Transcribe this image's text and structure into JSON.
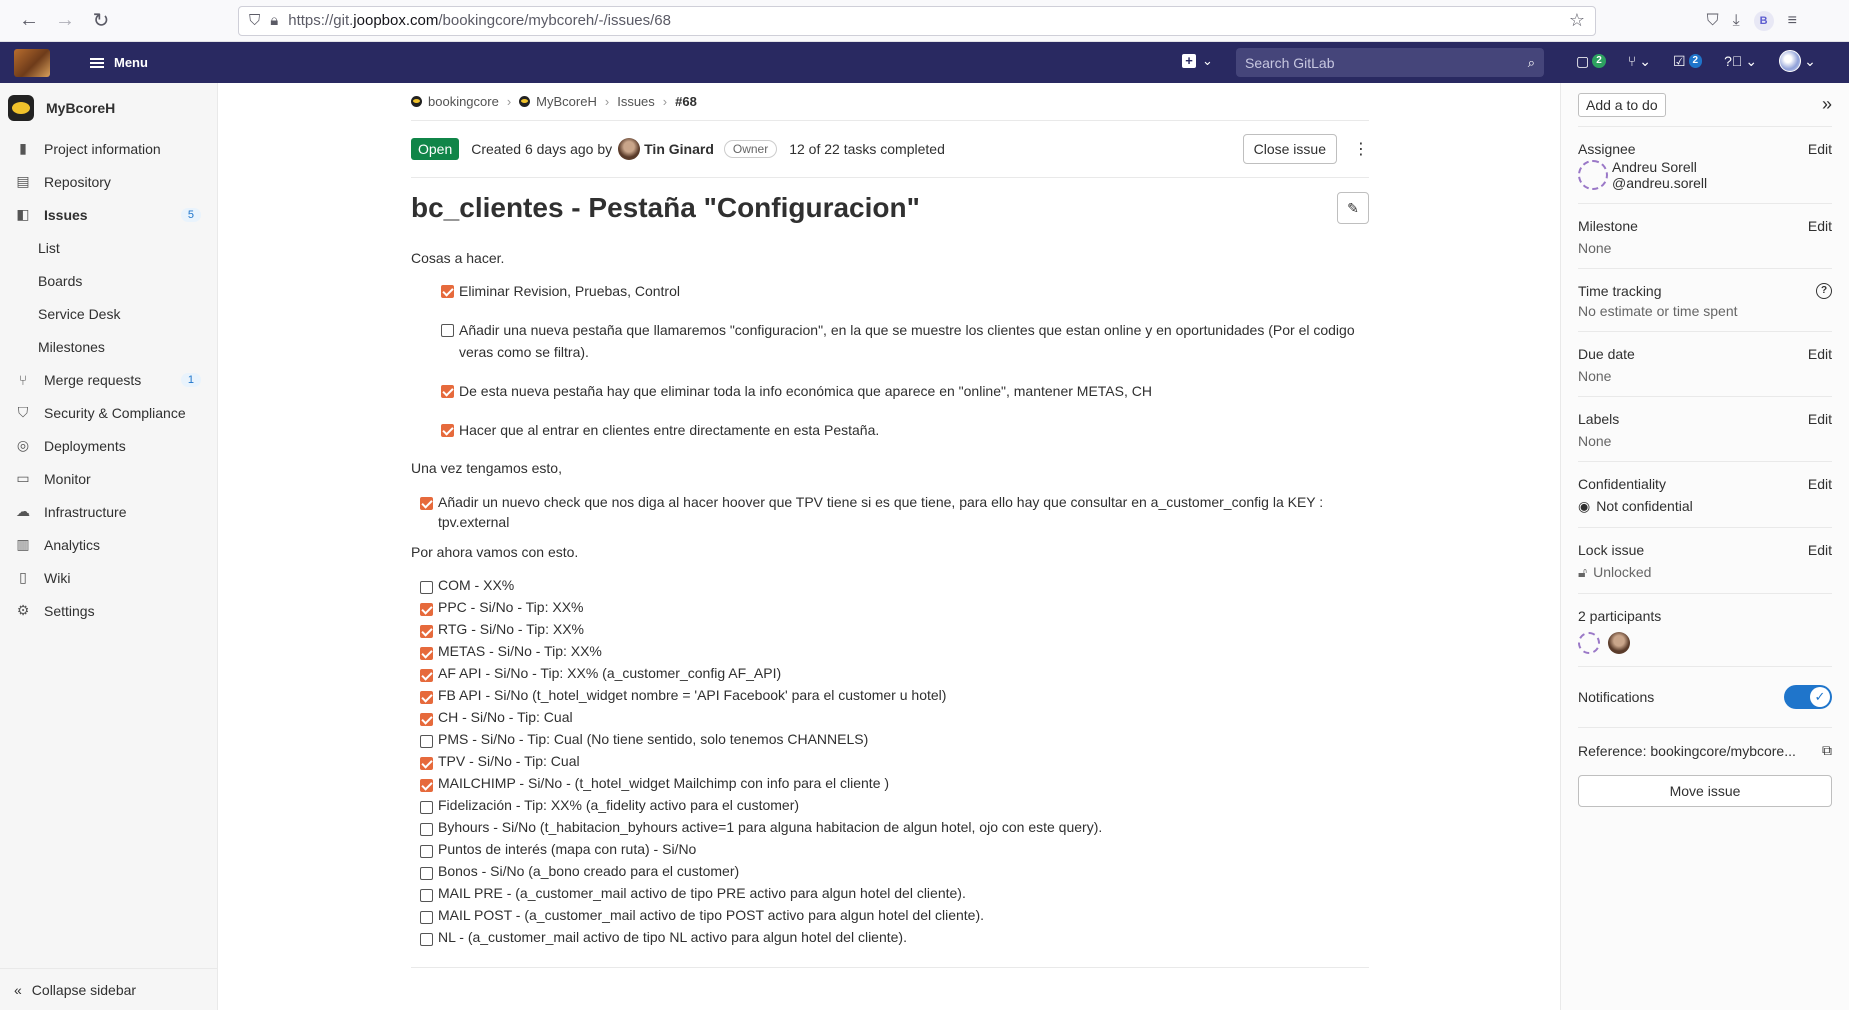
{
  "browser": {
    "url_prefix": "https://git.",
    "url_domain": "joopbox.com",
    "url_path": "/bookingcore/mybcoreh/-/issues/68",
    "profile_initial": "B"
  },
  "header": {
    "menu_label": "Menu",
    "search_placeholder": "Search GitLab",
    "issues_count": "2",
    "todos_count": "2"
  },
  "sidebar": {
    "project_name": "MyBcoreH",
    "items": [
      {
        "label": "Project information",
        "icon": "info-icon"
      },
      {
        "label": "Repository",
        "icon": "book-icon"
      },
      {
        "label": "Issues",
        "icon": "issues-icon",
        "badge": "5"
      },
      {
        "label": "List"
      },
      {
        "label": "Boards"
      },
      {
        "label": "Service Desk"
      },
      {
        "label": "Milestones"
      },
      {
        "label": "Merge requests",
        "icon": "merge-icon",
        "badge": "1"
      },
      {
        "label": "Security & Compliance",
        "icon": "shield-icon"
      },
      {
        "label": "Deployments",
        "icon": "rocket-icon"
      },
      {
        "label": "Monitor",
        "icon": "monitor-icon"
      },
      {
        "label": "Infrastructure",
        "icon": "cloud-icon"
      },
      {
        "label": "Analytics",
        "icon": "chart-icon"
      },
      {
        "label": "Wiki",
        "icon": "wiki-icon"
      },
      {
        "label": "Settings",
        "icon": "gear-icon"
      }
    ],
    "collapse_label": "Collapse sidebar"
  },
  "breadcrumb": {
    "group": "bookingcore",
    "project": "MyBcoreH",
    "section": "Issues",
    "current": "#68"
  },
  "issue": {
    "status": "Open",
    "created": "Created 6 days ago by",
    "author": "Tin Ginard",
    "role": "Owner",
    "tasks_summary": "12 of 22 tasks completed",
    "close_label": "Close issue",
    "title": "bc_clientes - Pestaña \"Configuracion\"",
    "intro": "Cosas a hacer.",
    "list1": [
      {
        "text": "Eliminar Revision, Pruebas, Control",
        "checked": true
      },
      {
        "text": "Añadir una nueva pestaña que llamaremos \"configuracion\", en la que se muestre los clientes que estan online y en oportunidades (Por el codigo veras como se filtra).",
        "checked": false
      },
      {
        "text": "De esta nueva pestaña hay que eliminar toda la info económica que aparece en \"online\", mantener METAS, CH",
        "checked": true
      },
      {
        "text": "Hacer que al entrar en clientes entre directamente en esta Pestaña.",
        "checked": true
      }
    ],
    "para2": "Una vez tengamos esto,",
    "list2": [
      {
        "text": "Añadir un nuevo check que nos diga al hacer hoover que TPV tiene si es que tiene, para ello hay que consultar en a_customer_config la KEY : tpv.external",
        "checked": true
      }
    ],
    "para3": "Por ahora vamos con esto.",
    "list3": [
      {
        "text": "COM - XX%",
        "checked": false
      },
      {
        "text": "PPC - Si/No - Tip: XX%",
        "checked": true
      },
      {
        "text": "RTG - Si/No - Tip: XX%",
        "checked": true
      },
      {
        "text": "METAS - Si/No - Tip: XX%",
        "checked": true
      },
      {
        "text": "AF API - Si/No - Tip: XX% (a_customer_config AF_API)",
        "checked": true
      },
      {
        "text": "FB API - Si/No (t_hotel_widget nombre = 'API Facebook' para el customer u hotel)",
        "checked": true
      },
      {
        "text": "CH - Si/No - Tip: Cual",
        "checked": true
      },
      {
        "text": "PMS - Si/No - Tip: Cual (No tiene sentido, solo tenemos CHANNELS)",
        "checked": false
      },
      {
        "text": "TPV - Si/No - Tip: Cual",
        "checked": true
      },
      {
        "text": "MAILCHIMP - Si/No - (t_hotel_widget Mailchimp con info para el cliente )",
        "checked": true
      },
      {
        "text": "Fidelización - Tip: XX% (a_fidelity activo para el customer)",
        "checked": false
      },
      {
        "text": "Byhours - Si/No (t_habitacion_byhours active=1 para alguna habitacion de algun hotel, ojo con este query).",
        "checked": false
      },
      {
        "text": "Puntos de interés (mapa con ruta) - Si/No",
        "checked": false
      },
      {
        "text": "Bonos - Si/No (a_bono creado para el customer)",
        "checked": false
      },
      {
        "text": "MAIL PRE - (a_customer_mail activo de tipo PRE activo para algun hotel del cliente).",
        "checked": false
      },
      {
        "text": "MAIL POST - (a_customer_mail activo de tipo POST activo para algun hotel del cliente).",
        "checked": false
      },
      {
        "text": "NL - (a_customer_mail activo de tipo NL activo para algun hotel del cliente).",
        "checked": false
      }
    ]
  },
  "rside": {
    "todo_label": "Add a to do",
    "edit_label": "Edit",
    "assignee_title": "Assignee",
    "assignee_name": "Andreu Sorell",
    "assignee_handle": "@andreu.sorell",
    "milestone_title": "Milestone",
    "milestone_val": "None",
    "time_title": "Time tracking",
    "time_val": "No estimate or time spent",
    "due_title": "Due date",
    "due_val": "None",
    "labels_title": "Labels",
    "labels_val": "None",
    "conf_title": "Confidentiality",
    "conf_val": "Not confidential",
    "lock_title": "Lock issue",
    "lock_val": "Unlocked",
    "participants_title": "2 participants",
    "notifications_title": "Notifications",
    "notifications_on": true,
    "reference": "Reference: bookingcore/mybcore...",
    "move_label": "Move issue"
  }
}
